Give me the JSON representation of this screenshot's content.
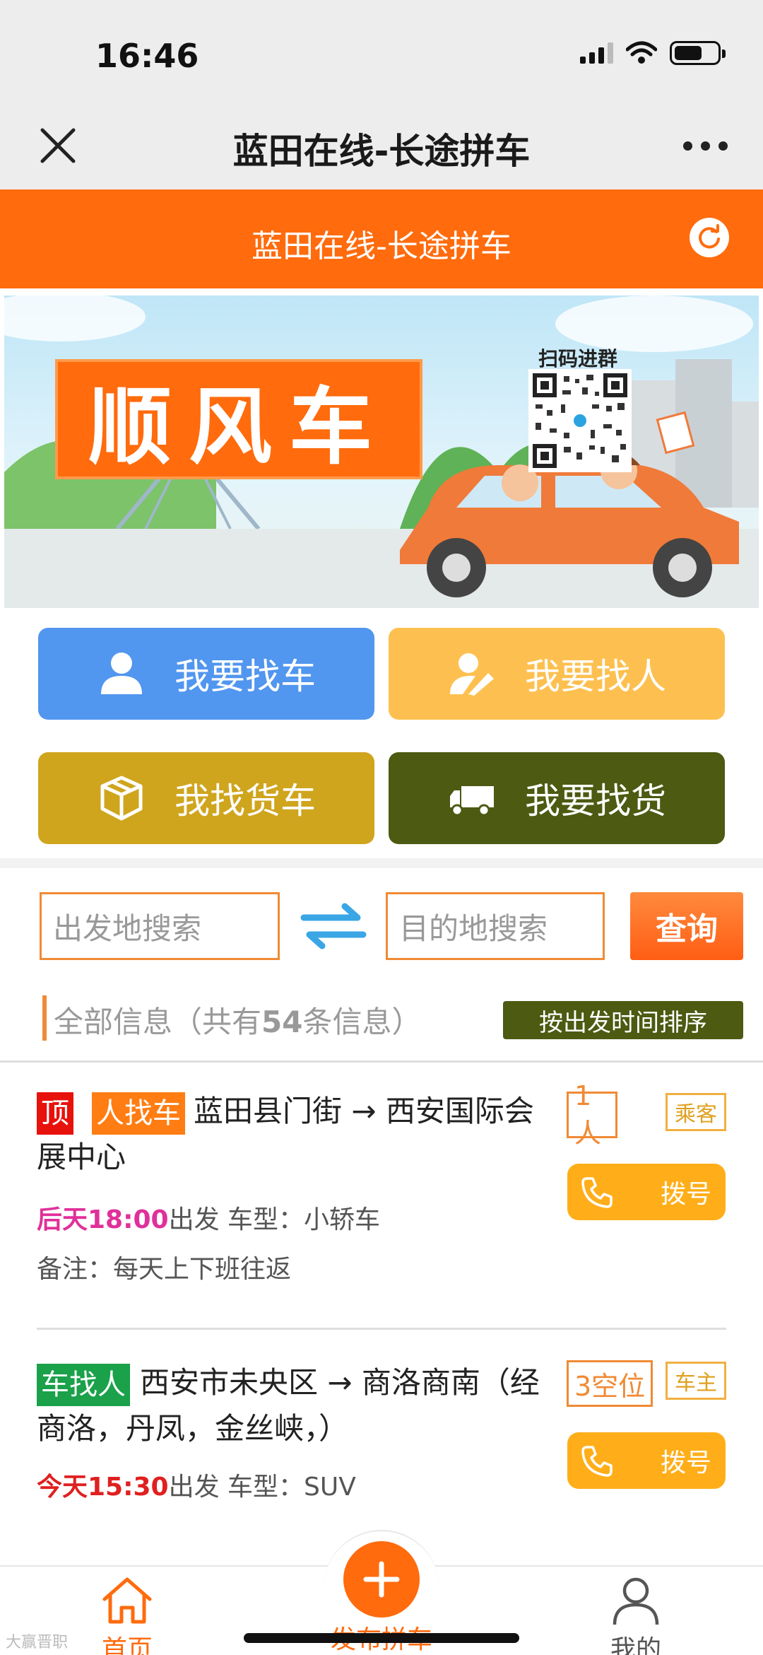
{
  "status_bar": {
    "time": "16:46"
  },
  "nav": {
    "title": "蓝田在线-长途拼车"
  },
  "header": {
    "title": "蓝田在线-长途拼车"
  },
  "banner": {
    "label": "顺风车",
    "qr_caption": "扫码进群"
  },
  "actions": [
    {
      "label": "我要找车",
      "icon": "person-icon",
      "color": "#5196ef"
    },
    {
      "label": "我要找人",
      "icon": "person-edit-icon",
      "color": "#fdc050"
    },
    {
      "label": "我找货车",
      "icon": "package-icon",
      "color": "#cfa51e"
    },
    {
      "label": "我要找货",
      "icon": "truck-icon",
      "color": "#4c5a12"
    }
  ],
  "search": {
    "from_placeholder": "出发地搜索",
    "to_placeholder": "目的地搜索",
    "query_label": "查询"
  },
  "list_header": {
    "prefix": "全部信息（共有",
    "count": "54",
    "suffix": "条信息）",
    "sort_label": "按出发时间排序"
  },
  "listings": [
    {
      "top_tag": "顶",
      "type_tag": "人找车",
      "route": "蓝田县门街 → 西安国际会展中心",
      "time": "后天18:00",
      "depart_suffix": "出发 车型：小轿车",
      "note": "备注：每天上下班往返",
      "seats": "1人",
      "role": "乘客",
      "dial_label": "拨号"
    },
    {
      "type_tag": "车找人",
      "route": "西安市未央区 → 商洛商南（经商洛，丹凤，金丝峡，）",
      "time": "今天15:30",
      "depart_suffix": "出发 车型：SUV",
      "seats": "3空位",
      "role": "车主",
      "dial_label": "拨号"
    }
  ],
  "tab_bar": {
    "home": "首页",
    "publish": "发布拼车",
    "mine": "我的"
  },
  "watermark": "大赢晋职",
  "colors": {
    "brand_orange": "#ff6b0d",
    "dial_yellow": "#ffae1a",
    "pink_time": "#e0309a",
    "red_time": "#e02020"
  }
}
